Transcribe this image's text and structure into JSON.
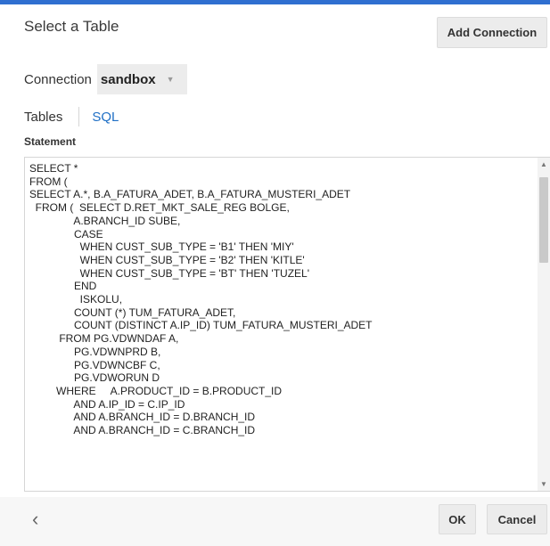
{
  "dialog": {
    "title": "Select a Table",
    "add_connection_label": "Add Connection"
  },
  "connection": {
    "label": "Connection",
    "value": "sandbox"
  },
  "tabs": [
    {
      "label": "Tables"
    },
    {
      "label": "SQL",
      "active": true
    }
  ],
  "statement": {
    "label": "Statement",
    "text": "SELECT *\nFROM (\nSELECT A.*, B.A_FATURA_ADET, B.A_FATURA_MUSTERI_ADET\n  FROM (  SELECT D.RET_MKT_SALE_REG BOLGE,\n               A.BRANCH_ID SUBE,\n               CASE\n                 WHEN CUST_SUB_TYPE = 'B1' THEN 'MIY'\n                 WHEN CUST_SUB_TYPE = 'B2' THEN 'KITLE'\n                 WHEN CUST_SUB_TYPE = 'BT' THEN 'TUZEL'\n               END\n                 ISKOLU,\n               COUNT (*) TUM_FATURA_ADET,\n               COUNT (DISTINCT A.IP_ID) TUM_FATURA_MUSTERI_ADET\n          FROM PG.VDWNDAF A,\n               PG.VDWNPRD B,\n               PG.VDWNCBF C,\n               PG.VDWORUN D\n         WHERE     A.PRODUCT_ID = B.PRODUCT_ID\n               AND A.IP_ID = C.IP_ID\n               AND A.BRANCH_ID = D.BRANCH_ID\n               AND A.BRANCH_ID = C.BRANCH_ID"
  },
  "footer": {
    "ok_label": "OK",
    "cancel_label": "Cancel"
  },
  "colors": {
    "accent_bar": "#2f6fd0",
    "sql_tab": "#1f6fc5",
    "button_bg": "#ececec"
  },
  "icons": {
    "dropdown": "chevron-down-icon",
    "back": "chevron-left-icon",
    "scroll_up": "arrow-up-icon",
    "scroll_down": "arrow-down-icon"
  }
}
